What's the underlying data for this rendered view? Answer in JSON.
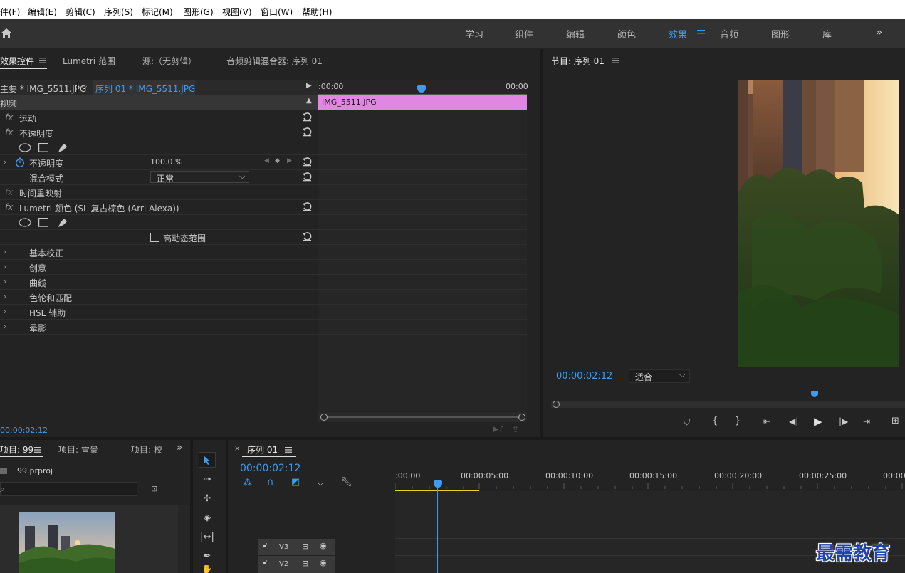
{
  "menu": [
    "件(F)",
    "编辑(E)",
    "剪辑(C)",
    "序列(S)",
    "标记(M)",
    "图形(G)",
    "视图(V)",
    "窗口(W)",
    "帮助(H)"
  ],
  "workspaces": [
    {
      "label": "学习",
      "active": false
    },
    {
      "label": "组件",
      "active": false
    },
    {
      "label": "编辑",
      "active": false
    },
    {
      "label": "颜色",
      "active": false
    },
    {
      "label": "效果",
      "active": true
    },
    {
      "label": "音频",
      "active": false
    },
    {
      "label": "图形",
      "active": false
    },
    {
      "label": "库",
      "active": false
    }
  ],
  "effect_panel": {
    "tabs": [
      "效果控件",
      "Lumetri 范围",
      "源:（无剪辑）",
      "音频剪辑混合器: 序列 01"
    ],
    "master_clip": "主要 * IMG_5511.JPG",
    "seq_clip": "序列 01 * IMG_5511.JPG",
    "video_header": "视频",
    "rows": {
      "motion": "运动",
      "opacity": "不透明度",
      "opacity_param": "不透明度",
      "opacity_value": "100.0 %",
      "blend_mode": "混合模式",
      "blend_value": "正常",
      "time_remap": "时间重映射",
      "lumetri": "Lumetri 颜色 (SL 复古棕色 (Arri Alexa))",
      "hdr": "高动态范围",
      "basic": "基本校正",
      "creative": "创意",
      "curves": "曲线",
      "wheels": "色轮和匹配",
      "hsl": "HSL 辅助",
      "vignette": "晕影"
    },
    "timecode_start": ":00:00",
    "timecode_end": "00:00",
    "clip_name": "IMG_5511.JPG",
    "current_time": "00:00:02:12",
    "fx_glyph": "fx"
  },
  "program": {
    "title": "节目: 序列 01",
    "timecode": "00:00:02:12",
    "fit": "适合"
  },
  "project": {
    "tabs": [
      "项目: 99",
      "项目: 雪景",
      "项目: 校"
    ],
    "file": "99.prproj"
  },
  "timeline": {
    "title": "序列 01",
    "timecode": "00:00:02:12",
    "ruler": [
      ":00:00",
      "00:00:05:00",
      "00:00:10:00",
      "00:00:15:00",
      "00:00:20:00",
      "00:00:25:00",
      "00:00:"
    ],
    "tracks": [
      "V3",
      "V2"
    ]
  },
  "watermark": "最需教育",
  "colors": {
    "accent": "#3f9bf0",
    "clip": "#e286e4",
    "work_area": "#e8d11f"
  }
}
